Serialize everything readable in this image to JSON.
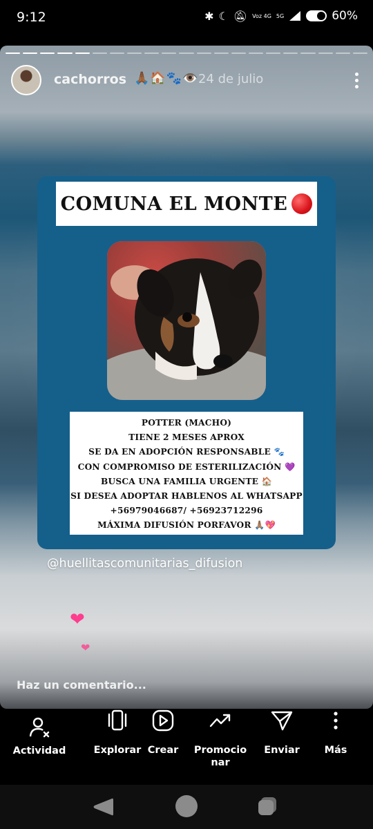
{
  "status_bar": {
    "time": "9:12",
    "network_label": "Voz 4G",
    "network_type": "5G",
    "battery": "60%"
  },
  "story": {
    "username": "cachorros",
    "emojis": "🙏🏾🏠🐾👁️",
    "date": "24 de julio",
    "mention": "@huellitascomunitarias_difusion",
    "comment_placeholder": "Haz un comentario..."
  },
  "flyer": {
    "title": "COMUNA EL MONTE",
    "lines": [
      "POTTER (MACHO)",
      "TIENE 2 MESES APROX",
      "SE DA EN ADOPCIÓN RESPONSABLE 🐾",
      "CON COMPROMISO DE ESTERILIZACIÓN 💜",
      "BUSCA UNA FAMILIA URGENTE 🏠",
      "SI DESEA ADOPTAR HABLENOS AL WHATSAPP",
      "+56979046687/ +56923712296",
      "MÁXIMA DIFUSIÓN PORFAVOR 🙏🏽💖"
    ]
  },
  "bottom_nav": {
    "items": [
      {
        "label": "Actividad",
        "icon": "activity-icon"
      },
      {
        "label": "Explorar",
        "icon": "explore-icon"
      },
      {
        "label": "Crear",
        "icon": "create-icon"
      },
      {
        "label": "Promocionar",
        "icon": "promote-icon"
      },
      {
        "label": "Enviar",
        "icon": "send-icon"
      },
      {
        "label": "Más",
        "icon": "more-icon"
      }
    ]
  },
  "colors": {
    "flyer_background": "#155f8b",
    "heart": "#ff3d8e"
  }
}
